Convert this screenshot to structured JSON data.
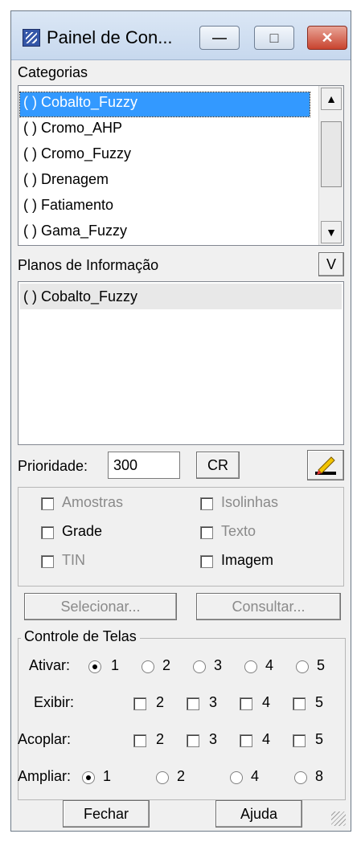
{
  "window": {
    "title": "Painel de Con..."
  },
  "categorias": {
    "label": "Categorias",
    "items": [
      "( ) Cobalto_Fuzzy",
      "( ) Cromo_AHP",
      "( ) Cromo_Fuzzy",
      "( ) Drenagem",
      "( ) Fatiamento",
      "( ) Gama_Fuzzy"
    ],
    "selected_index": 0
  },
  "planos": {
    "label": "Planos de Informação",
    "v_button": "V",
    "items": [
      "( ) Cobalto_Fuzzy"
    ]
  },
  "prioridade": {
    "label": "Prioridade:",
    "value": "300",
    "cr_button": "CR"
  },
  "visual": {
    "amostras": "Amostras",
    "isolinhas": "Isolinhas",
    "grade": "Grade",
    "texto": "Texto",
    "tin": "TIN",
    "imagem": "Imagem"
  },
  "actions": {
    "selecionar": "Selecionar...",
    "consultar": "Consultar..."
  },
  "controle": {
    "legend": "Controle de Telas",
    "ativar_label": "Ativar:",
    "ativar_options": [
      "1",
      "2",
      "3",
      "4",
      "5"
    ],
    "ativar_selected": "1",
    "exibir_label": "Exibir:",
    "exibir_options": [
      "2",
      "3",
      "4",
      "5"
    ],
    "acoplar_label": "Acoplar:",
    "acoplar_options": [
      "2",
      "3",
      "4",
      "5"
    ],
    "ampliar_label": "Ampliar:",
    "ampliar_options": [
      "1",
      "2",
      "4",
      "8"
    ],
    "ampliar_selected": "1"
  },
  "footer": {
    "fechar": "Fechar",
    "ajuda": "Ajuda"
  },
  "colors": {
    "selection": "#3399ff",
    "window_bg": "#f0f0f0",
    "close_red": "#c8432f"
  }
}
